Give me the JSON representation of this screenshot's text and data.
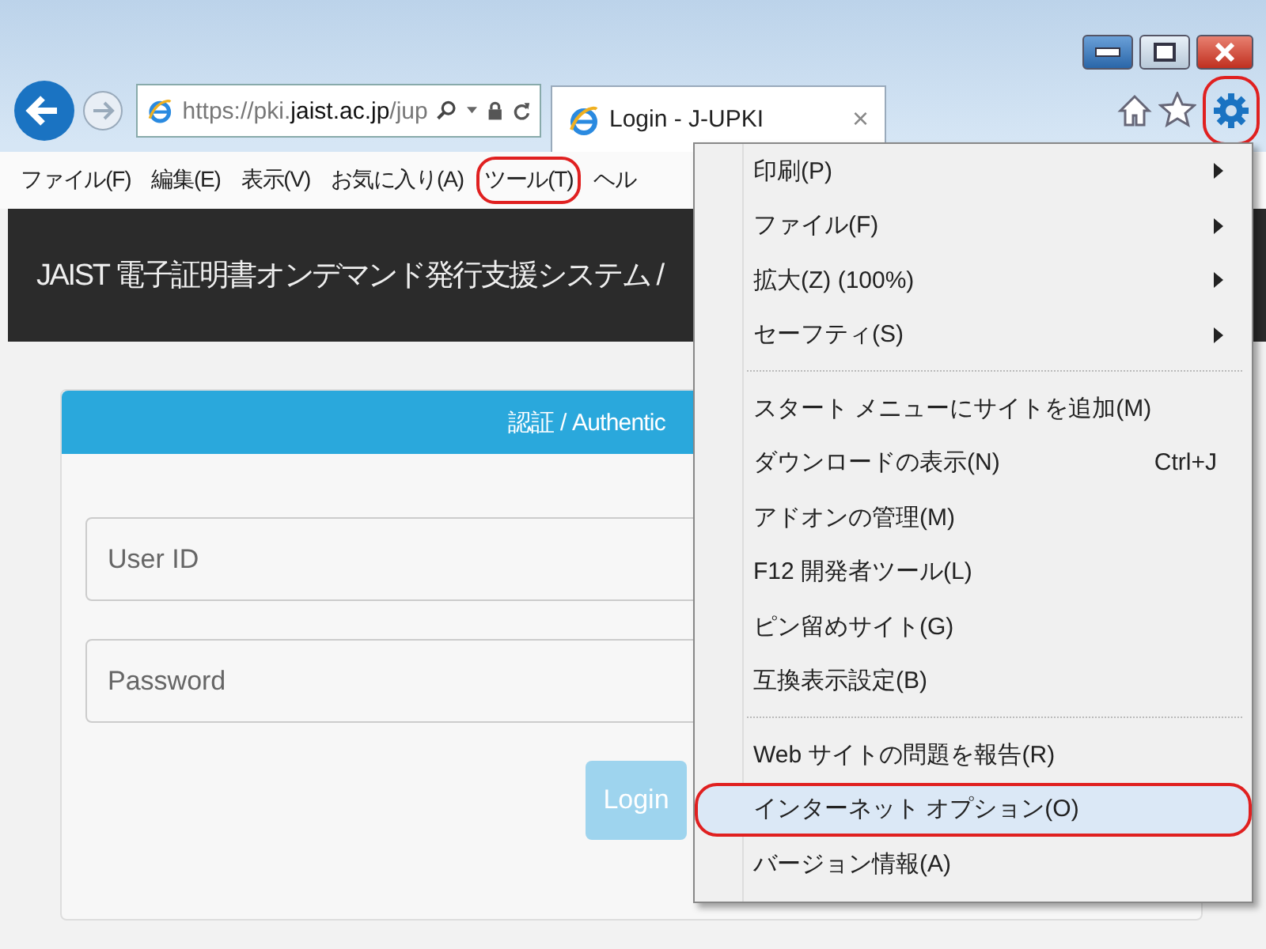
{
  "address_bar": {
    "url_prefix": "https://pki.",
    "url_domain": "jaist.ac.jp",
    "url_suffix": "/jup"
  },
  "tabs": [
    {
      "title": "Login - J-UPKI",
      "selected": true,
      "close": "×"
    }
  ],
  "toolbar": {
    "tools_highlighted": true
  },
  "menu_bar": [
    {
      "label": "ファイル(F)",
      "highlighted": false
    },
    {
      "label": "編集(E)",
      "highlighted": false
    },
    {
      "label": "表示(V)",
      "highlighted": false
    },
    {
      "label": "お気に入り(A)",
      "highlighted": false
    },
    {
      "label": "ツール(T)",
      "highlighted": true
    },
    {
      "label": "ヘル",
      "highlighted": false
    }
  ],
  "page": {
    "header_title": "JAIST 電子証明書オンデマンド発行支援システム /",
    "card": {
      "title": "認証 / Authentic",
      "fields": [
        {
          "placeholder": "User ID"
        },
        {
          "placeholder": "Password"
        }
      ],
      "button": {
        "label": "Login",
        "disabled": true
      }
    }
  },
  "tools_menu": [
    {
      "kind": "item",
      "label": "印刷(P)",
      "submenu": true,
      "hovered": false,
      "highlighted": false
    },
    {
      "kind": "item",
      "label": "ファイル(F)",
      "submenu": true,
      "hovered": false,
      "highlighted": false
    },
    {
      "kind": "item",
      "label": "拡大(Z) (100%)",
      "submenu": true,
      "hovered": false,
      "highlighted": false
    },
    {
      "kind": "item",
      "label": "セーフティ(S)",
      "submenu": true,
      "hovered": false,
      "highlighted": false
    },
    {
      "kind": "separator"
    },
    {
      "kind": "item",
      "label": "スタート メニューにサイトを追加(M)",
      "submenu": false,
      "hovered": false,
      "highlighted": false
    },
    {
      "kind": "item",
      "label": "ダウンロードの表示(N)",
      "shortcut": "Ctrl+J",
      "submenu": false,
      "hovered": false,
      "highlighted": false
    },
    {
      "kind": "item",
      "label": "アドオンの管理(M)",
      "submenu": false,
      "hovered": false,
      "highlighted": false
    },
    {
      "kind": "item",
      "label": "F12 開発者ツール(L)",
      "submenu": false,
      "hovered": false,
      "highlighted": false
    },
    {
      "kind": "item",
      "label": "ピン留めサイト(G)",
      "submenu": false,
      "hovered": false,
      "highlighted": false
    },
    {
      "kind": "item",
      "label": "互換表示設定(B)",
      "submenu": false,
      "hovered": false,
      "highlighted": false
    },
    {
      "kind": "separator"
    },
    {
      "kind": "item",
      "label": "Web サイトの問題を報告(R)",
      "submenu": false,
      "hovered": false,
      "highlighted": false
    },
    {
      "kind": "item",
      "label": "インターネット オプション(O)",
      "submenu": false,
      "hovered": true,
      "highlighted": true
    },
    {
      "kind": "item",
      "label": "バージョン情報(A)",
      "submenu": false,
      "hovered": false,
      "highlighted": false
    }
  ]
}
